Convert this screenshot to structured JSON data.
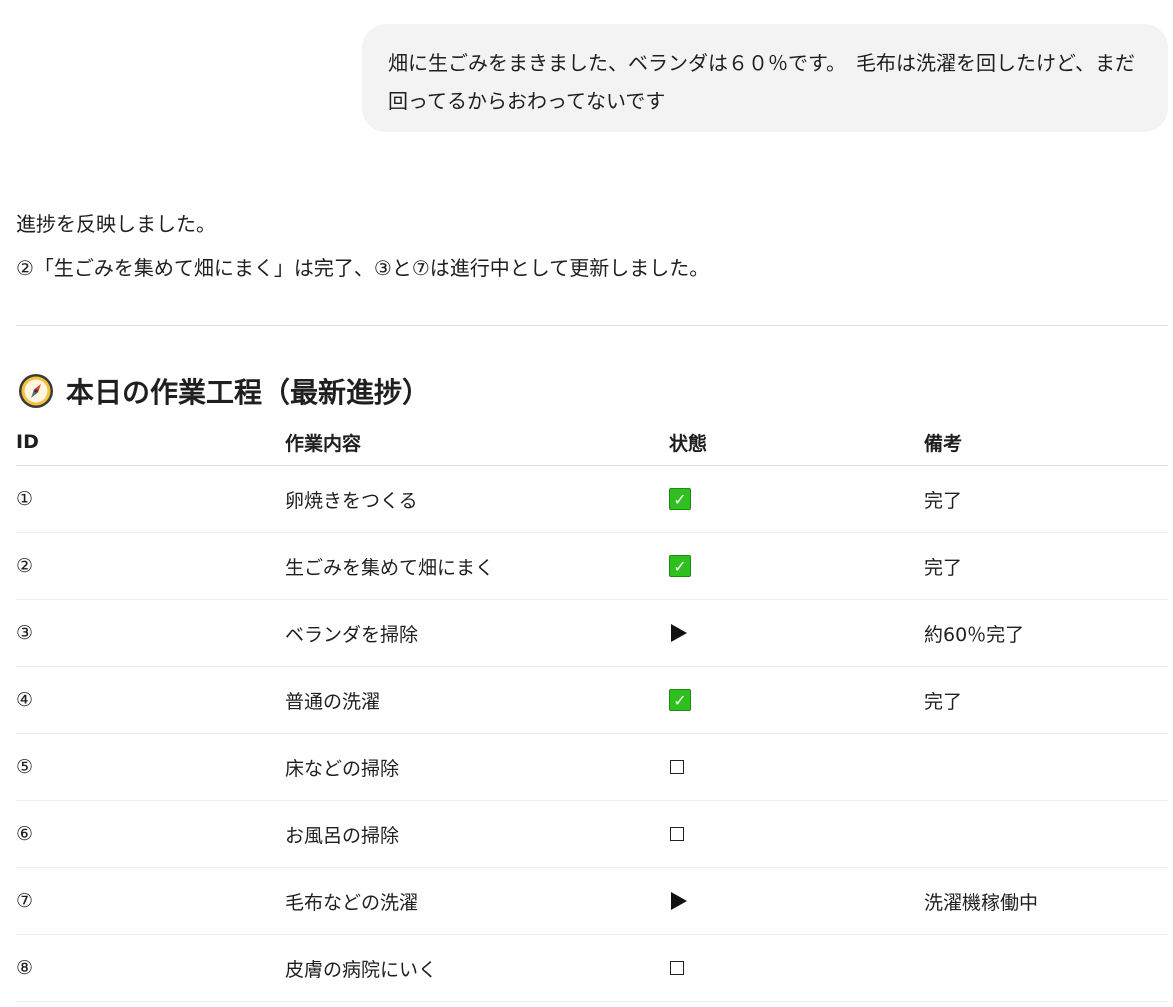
{
  "user_message": {
    "line1": "畑に生ごみをまきました、ベランダは６０％です。　毛布は洗濯を回したけど、まだ",
    "line2": "回ってるからおわってないです"
  },
  "assistant_message": {
    "line1": "進捗を反映しました。",
    "line2": "②「生ごみを集めて畑にまく」は完了、③と⑦は進行中として更新しました。"
  },
  "section": {
    "icon": "compass-icon",
    "title": "本日の作業工程（最新進捗）"
  },
  "table": {
    "headers": {
      "id": "ID",
      "task": "作業内容",
      "status": "状態",
      "note": "備考"
    },
    "rows": [
      {
        "id": "①",
        "task": "卵焼きをつくる",
        "status": "done",
        "note": "完了"
      },
      {
        "id": "②",
        "task": "生ごみを集めて畑にまく",
        "status": "done",
        "note": "完了"
      },
      {
        "id": "③",
        "task": "ベランダを掃除",
        "status": "in-progress",
        "note": "約60％完了"
      },
      {
        "id": "④",
        "task": "普通の洗濯",
        "status": "done",
        "note": "完了"
      },
      {
        "id": "⑤",
        "task": "床などの掃除",
        "status": "todo",
        "note": ""
      },
      {
        "id": "⑥",
        "task": "お風呂の掃除",
        "status": "todo",
        "note": ""
      },
      {
        "id": "⑦",
        "task": "毛布などの洗濯",
        "status": "in-progress",
        "note": "洗濯機稼働中"
      },
      {
        "id": "⑧",
        "task": "皮膚の病院にいく",
        "status": "todo",
        "note": ""
      }
    ]
  },
  "colors": {
    "check_green": "#2fbf1f",
    "bubble_bg": "#f3f3f3"
  },
  "status_icons": {
    "done": "check-mark-icon",
    "in-progress": "play-icon",
    "todo": "empty-box-icon"
  }
}
